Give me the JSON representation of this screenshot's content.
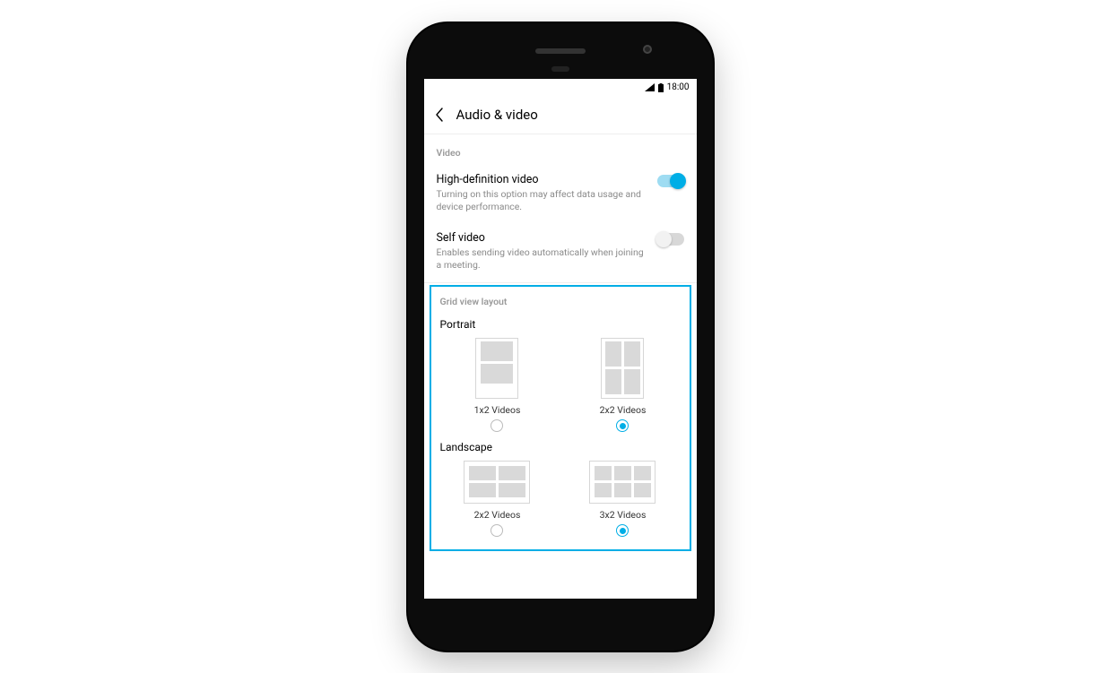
{
  "status": {
    "time": "18:00"
  },
  "header": {
    "title": "Audio & video"
  },
  "video": {
    "section_label": "Video",
    "hd": {
      "title": "High-definition video",
      "desc": "Turning on this option may affect data usage and device performance.",
      "on": true
    },
    "self": {
      "title": "Self video",
      "desc": "Enables sending video automatically when joining a meeting.",
      "on": false
    }
  },
  "grid": {
    "section_label": "Grid view layout",
    "portrait": {
      "label": "Portrait",
      "options": [
        {
          "label": "1x2 Videos",
          "selected": false
        },
        {
          "label": "2x2 Videos",
          "selected": true
        }
      ]
    },
    "landscape": {
      "label": "Landscape",
      "options": [
        {
          "label": "2x2 Videos",
          "selected": false
        },
        {
          "label": "3x2 Videos",
          "selected": true
        }
      ]
    }
  },
  "colors": {
    "accent": "#00aee6"
  }
}
